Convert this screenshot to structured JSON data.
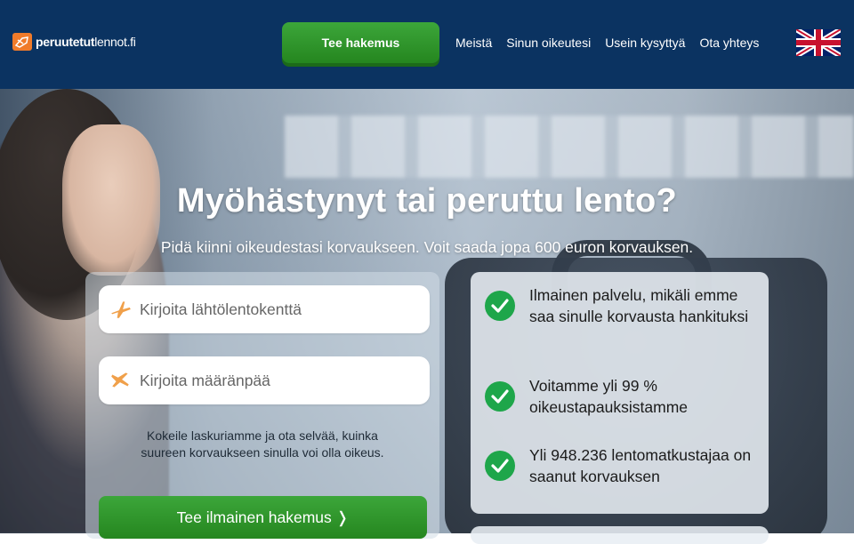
{
  "header": {
    "logo": {
      "bold": "peruutetut",
      "light": "lennot.fi"
    },
    "cta_label": "Tee hakemus",
    "nav": [
      "Meistä",
      "Sinun oikeutesi",
      "Usein kysyttyä",
      "Ota yhteys"
    ],
    "language_flag": "uk-flag-icon"
  },
  "hero": {
    "title": "Myöhästynyt tai peruttu lento?",
    "subtitle": "Pidä kiinni oikeudestasi korvaukseen. Voit saada jopa 600 euron korvauksen."
  },
  "form": {
    "departure_placeholder": "Kirjoita lähtölentokenttä",
    "arrival_placeholder": "Kirjoita määränpää",
    "calculator_text": "Kokeile laskuriamme ja ota selvää, kuinka suureen korvaukseen sinulla voi olla oikeus.",
    "submit_label": "Tee ilmainen hakemus ❭"
  },
  "benefits": [
    "Ilmainen palvelu, mikäli emme saa sinulle korvausta hankituksi",
    "Voitamme yli 99 % oikeustapauksistamme",
    "Yli 948.236 lentomatkustajaa on saanut korvauksen"
  ],
  "colors": {
    "header_bg": "#0b3361",
    "brand_orange": "#f07b2a",
    "cta_green": "#2f9a2c",
    "check_green": "#1ea64a",
    "plane_icon": "#f0a04a"
  }
}
